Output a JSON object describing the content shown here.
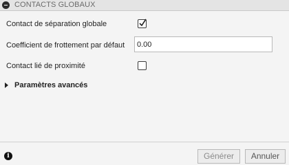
{
  "header": {
    "title": "CONTACTS GLOBAUX",
    "collapse_icon": "minus-circle-icon"
  },
  "form": {
    "separation": {
      "label": "Contact de séparation globale",
      "checked": true
    },
    "friction": {
      "label": "Coefficient de frottement par défaut",
      "value": "0.00"
    },
    "proximity": {
      "label": "Contact lié de proximité",
      "checked": false
    },
    "advanced": {
      "label": "Paramètres avancés",
      "expanded": false
    }
  },
  "footer": {
    "info_icon": "info-icon",
    "generate_label": "Générer",
    "cancel_label": "Annuler"
  }
}
